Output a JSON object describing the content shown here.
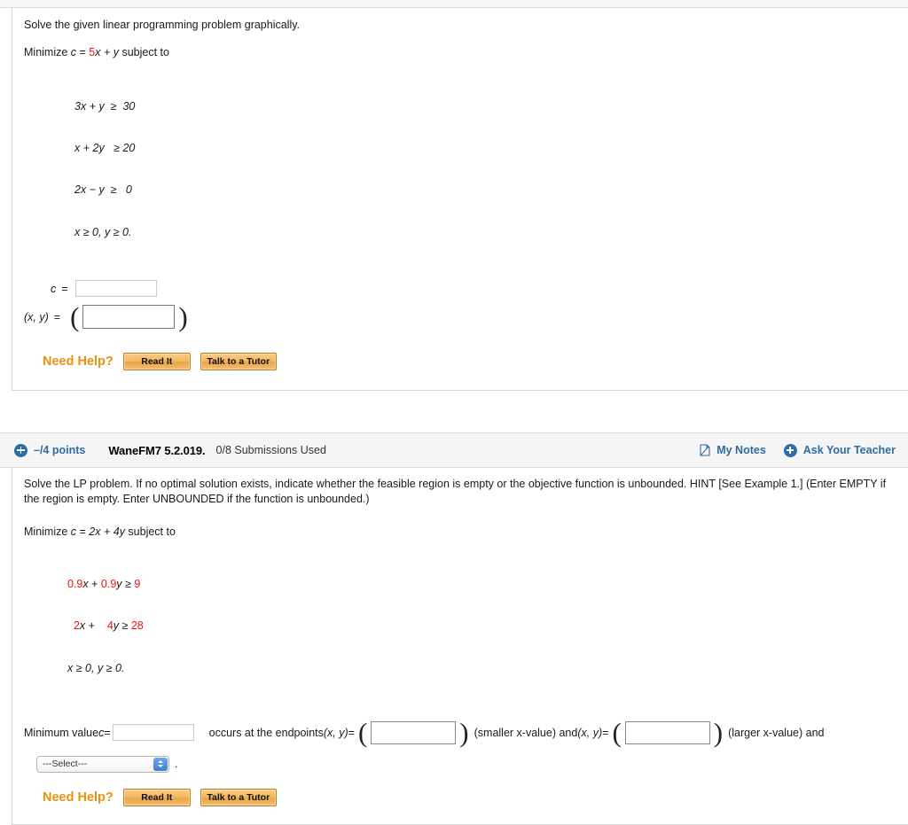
{
  "question1": {
    "prompt": "Solve the given linear programming problem graphically.",
    "objective_prefix": "Minimize ",
    "objective_var": "c",
    "objective_eq": " = ",
    "objective_coeff": "5",
    "objective_rest": "x + y",
    "objective_suffix": " subject to",
    "constraints": [
      "3x + y  ≥  30",
      "x + 2y   ≥ 20",
      "2x − y  ≥   0",
      "x ≥ 0, y ≥ 0."
    ],
    "answer_c_label": "c",
    "answer_c_equals": "=",
    "answer_c_value": "",
    "answer_xy_label": "(x, y)",
    "answer_xy_equals": "=",
    "answer_xy_value": "",
    "paren_open": "(",
    "paren_close": ")",
    "need_help_label": "Need Help?",
    "read_it_label": "Read It",
    "talk_tutor_label": "Talk to a Tutor"
  },
  "question2": {
    "header": {
      "plus_icon": "plus-circle-icon",
      "points": "–/4 points",
      "question_label": "WaneFM7 5.2.019.",
      "submissions": "0/8 Submissions Used",
      "my_notes_icon": "note-page-icon",
      "my_notes_label": "My Notes",
      "ask_teacher_icon": "plus-circle-icon",
      "ask_teacher_label": "Ask Your Teacher"
    },
    "prompt": "Solve the LP problem. If no optimal solution exists, indicate whether the feasible region is empty or the objective function is unbounded. HINT [See Example 1.] (Enter EMPTY if the region is empty. Enter UNBOUNDED if the function is unbounded.)",
    "objective_prefix": "Minimize ",
    "objective_var": "c",
    "objective_eq": " = ",
    "objective_rest": "2x + 4y",
    "objective_suffix": " subject to",
    "constraint1": {
      "a": "0.9",
      "x": "x",
      "plus": " + ",
      "b": "0.9",
      "y": "y",
      "rel": " ≥ ",
      "rhs": "9"
    },
    "constraint2": {
      "a": "2",
      "x": "x",
      "plus": " +    ",
      "b": "4",
      "y": "y",
      "rel": " ≥ ",
      "rhs": "28"
    },
    "constraint3": "x ≥ 0, y ≥ 0.",
    "answer": {
      "min_label": "Minimum value ",
      "min_var": "c",
      "min_equals": " = ",
      "min_value": "",
      "occurs_text": "occurs at the endpoints ",
      "endpoint_label": "(x, y)",
      "endpoint_equals": " = ",
      "paren_open": "(",
      "paren_close": ")",
      "endpoint1_value": "",
      "smaller_note": "(smaller x-value) and ",
      "and_label2": "(x, y)",
      "and_equals2": " = ",
      "endpoint2_value": "",
      "larger_note": "(larger x-value) and"
    },
    "select": {
      "selected": "---Select---",
      "period": "."
    },
    "need_help_label": "Need Help?",
    "read_it_label": "Read It",
    "talk_tutor_label": "Talk to a Tutor"
  },
  "colors": {
    "link_blue": "#2c6da3",
    "red_highlight": "#ee1111",
    "orange_help": "#e8920c",
    "button_orange": "#e9a542"
  }
}
